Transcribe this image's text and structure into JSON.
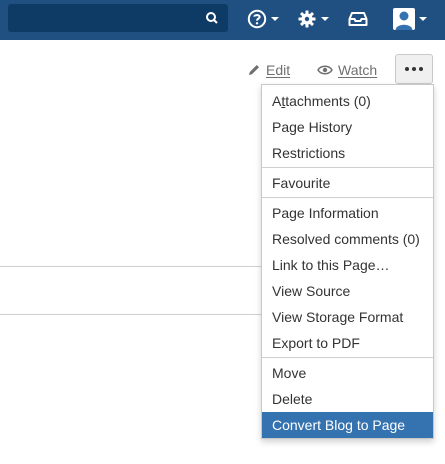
{
  "header": {
    "search": {
      "placeholder": ""
    },
    "help": {
      "icon": "help-icon"
    },
    "settings": {
      "icon": "gear-icon"
    },
    "notifications": {
      "icon": "inbox-icon"
    },
    "user": {
      "icon": "user-avatar-icon"
    }
  },
  "toolbar": {
    "edit_label": "Edit",
    "watch_label": "Watch",
    "more_icon": "ellipsis-icon"
  },
  "menu": {
    "groups": [
      [
        {
          "first": "A",
          "mnemonic": "t",
          "rest": "tachments (0)"
        },
        {
          "label": "Page History"
        },
        {
          "label": "Restrictions"
        }
      ],
      [
        {
          "label": "Favourite"
        }
      ],
      [
        {
          "label": "Page Information"
        },
        {
          "label": "Resolved comments (0)"
        },
        {
          "label": "Link to this Page…"
        },
        {
          "label": "View Source"
        },
        {
          "label": "View Storage Format"
        },
        {
          "label": "Export to PDF"
        }
      ],
      [
        {
          "label": "Move"
        },
        {
          "label": "Delete"
        },
        {
          "label": "Convert Blog to Page",
          "active": true
        }
      ]
    ]
  },
  "colors": {
    "header_bg": "#205081",
    "search_bg": "#0e3b66",
    "highlight_bg": "#3572b0"
  }
}
